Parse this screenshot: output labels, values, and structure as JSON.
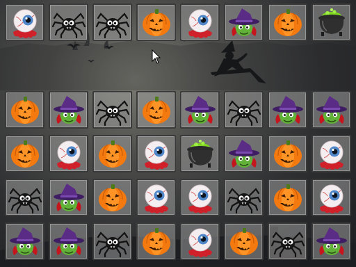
{
  "game": {
    "pieces": [
      "eyeball",
      "spider",
      "pumpkin",
      "witch",
      "cauldron"
    ],
    "board": [
      [
        "eyeball",
        "spider",
        "spider",
        "pumpkin",
        "eyeball",
        "witch",
        "pumpkin",
        "cauldron"
      ],
      null,
      [
        "pumpkin",
        "witch",
        "spider",
        "pumpkin",
        "witch",
        "spider",
        "witch",
        "witch"
      ],
      [
        "pumpkin",
        "eyeball",
        "pumpkin",
        "eyeball",
        "cauldron",
        "witch",
        "pumpkin",
        "eyeball"
      ],
      [
        "spider",
        "witch",
        "pumpkin",
        "eyeball",
        "eyeball",
        "spider",
        "pumpkin",
        "eyeball"
      ],
      [
        "witch",
        "witch",
        "spider",
        "pumpkin",
        "eyeball",
        "pumpkin",
        "spider",
        "witch"
      ]
    ]
  },
  "background": {
    "scene": "haunted-night",
    "colors": {
      "sky": "#5e605c",
      "silhouette": "#1b1c1f"
    }
  },
  "palette": {
    "pumpkin": "#f47a10",
    "witch_hat": "#5a2c86",
    "witch_face": "#62b23a",
    "eyeball_iris": "#4f86c8",
    "blood": "#d0202a",
    "cauldron_brew": "#7ed321"
  }
}
